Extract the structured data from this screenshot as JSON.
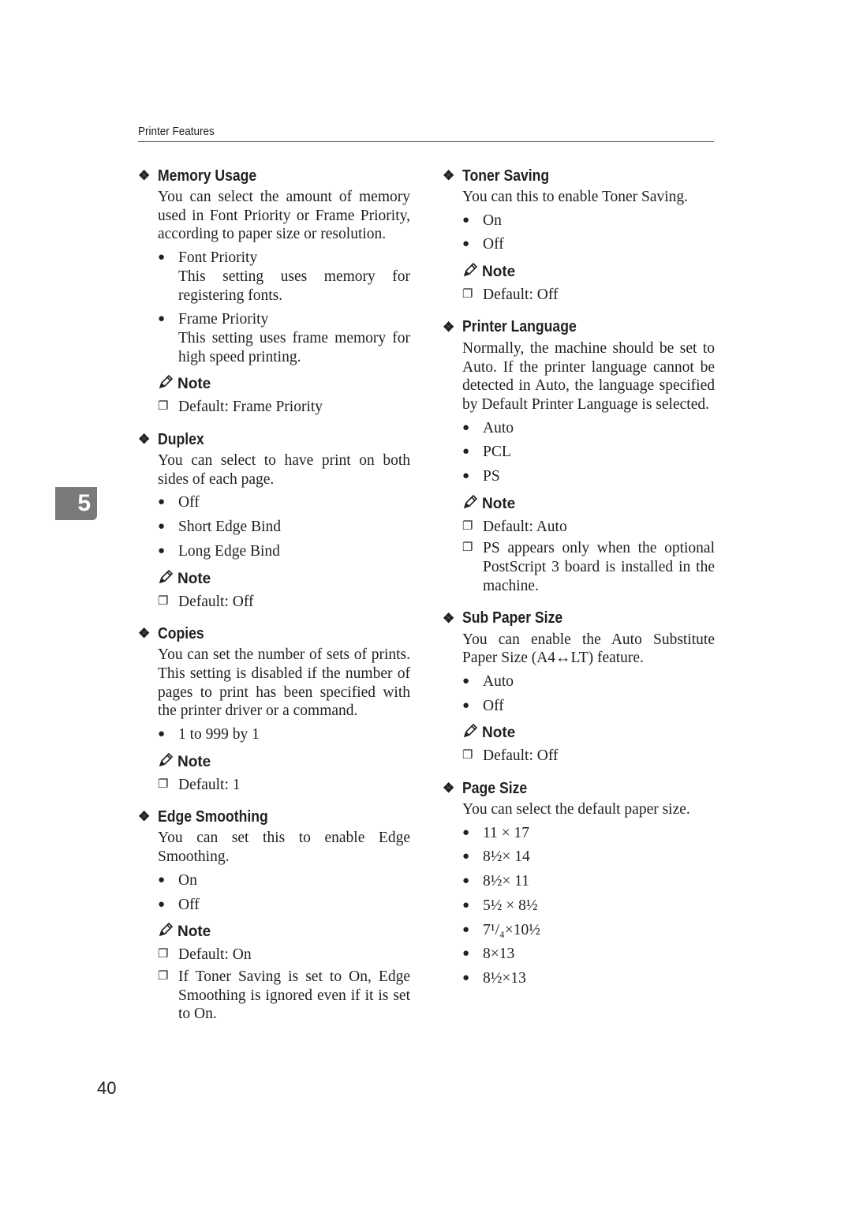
{
  "header": {
    "title": "Printer Features"
  },
  "chapter_tab": "5",
  "page_number": "40",
  "note_label": "Note",
  "left_column": [
    {
      "title": "Memory Usage",
      "text": "You can select the amount of memory used in Font Priority or Frame Priority, according to paper size or resolution.",
      "options": [
        {
          "label": "Font Priority",
          "desc": "This setting uses memory for registering fonts."
        },
        {
          "label": "Frame Priority",
          "desc": "This setting uses frame memory for high speed printing."
        }
      ],
      "notes": [
        "Default: Frame Priority"
      ]
    },
    {
      "title": "Duplex",
      "text": "You can select to have print on both sides of each page.",
      "options": [
        {
          "label": "Off"
        },
        {
          "label": "Short Edge Bind"
        },
        {
          "label": "Long Edge Bind"
        }
      ],
      "notes": [
        "Default: Off"
      ]
    },
    {
      "title": "Copies",
      "text": "You can set the number of sets of prints. This setting is disabled if the number of pages to print has been specified with the printer driver or a command.",
      "options": [
        {
          "label": "1 to 999 by 1"
        }
      ],
      "notes": [
        "Default: 1"
      ]
    },
    {
      "title": "Edge Smoothing",
      "text": "You can set this to enable Edge Smoothing.",
      "options": [
        {
          "label": "On"
        },
        {
          "label": "Off"
        }
      ],
      "notes": [
        "Default: On",
        "If Toner Saving is set to On, Edge Smoothing is ignored even if it is set to On."
      ]
    }
  ],
  "right_column": [
    {
      "title": "Toner Saving",
      "text": "You can this to enable Toner Saving.",
      "options": [
        {
          "label": "On"
        },
        {
          "label": "Off"
        }
      ],
      "notes": [
        "Default: Off"
      ]
    },
    {
      "title": "Printer Language",
      "text": "Normally, the machine should be set to Auto. If the printer language cannot be detected in Auto, the language specified by Default Printer Language is selected.",
      "options": [
        {
          "label": "Auto"
        },
        {
          "label": "PCL"
        },
        {
          "label": "PS"
        }
      ],
      "notes": [
        "Default: Auto",
        "PS appears only when the optional PostScript 3 board is installed in the machine."
      ]
    },
    {
      "title": "Sub Paper Size",
      "text": "You can enable the Auto Substitute Paper Size (A4↔LT) feature.",
      "options": [
        {
          "label": "Auto"
        },
        {
          "label": "Off"
        }
      ],
      "notes": [
        "Default: Off"
      ]
    },
    {
      "title": "Page Size",
      "text": "You can select the default paper size.",
      "options": [
        {
          "label": "11 × 17"
        },
        {
          "label": "8½× 14"
        },
        {
          "label": "8½× 11"
        },
        {
          "label": "5½ × 8½"
        },
        {
          "label": "7¹/₄×10½"
        },
        {
          "label": "8×13"
        },
        {
          "label": "8½×13"
        }
      ],
      "notes": []
    }
  ]
}
